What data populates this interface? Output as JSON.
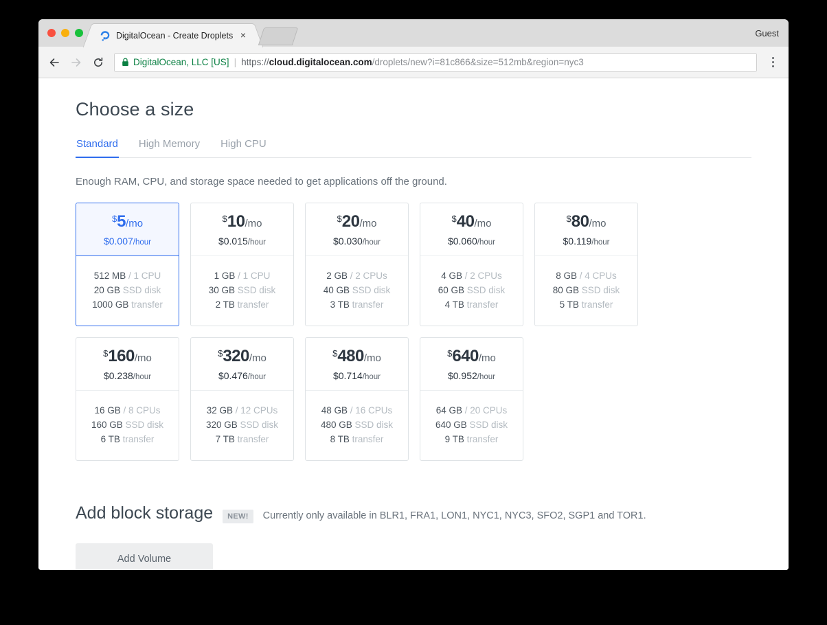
{
  "browser": {
    "tab": {
      "title": "DigitalOcean - Create Droplets",
      "favicon": "digitalocean-droplet-icon",
      "close": "×"
    },
    "profile_label": "Guest",
    "nav": {
      "back": "back-arrow-icon",
      "forward": "forward-arrow-icon",
      "reload": "reload-icon",
      "menu": "three-dot-menu-icon"
    },
    "omnibox": {
      "lock": "lock-icon",
      "security_name": "DigitalOcean, LLC [US]",
      "divider": "|",
      "url_scheme": "https://",
      "url_host": "cloud.digitalocean.com",
      "url_path": "/droplets/new?i=81c866&size=512mb&region=nyc3"
    }
  },
  "page": {
    "title": "Choose a size",
    "tabs": [
      {
        "label": "Standard",
        "active": true
      },
      {
        "label": "High Memory",
        "active": false
      },
      {
        "label": "High CPU",
        "active": false
      }
    ],
    "subtitle": "Enough RAM, CPU, and storage space needed to get applications off the ground.",
    "currency_symbol": "$",
    "per_month": "/mo",
    "per_hour": "/hour",
    "sizes": [
      {
        "price": "5",
        "hourly": "$0.007",
        "ram": "512 MB",
        "cpu": "1 CPU",
        "disk": "20 GB",
        "disk_label": "SSD disk",
        "transfer": "1000 GB",
        "transfer_label": "transfer",
        "selected": true
      },
      {
        "price": "10",
        "hourly": "$0.015",
        "ram": "1 GB",
        "cpu": "1 CPU",
        "disk": "30 GB",
        "disk_label": "SSD disk",
        "transfer": "2 TB",
        "transfer_label": "transfer",
        "selected": false
      },
      {
        "price": "20",
        "hourly": "$0.030",
        "ram": "2 GB",
        "cpu": "2 CPUs",
        "disk": "40 GB",
        "disk_label": "SSD disk",
        "transfer": "3 TB",
        "transfer_label": "transfer",
        "selected": false
      },
      {
        "price": "40",
        "hourly": "$0.060",
        "ram": "4 GB",
        "cpu": "2 CPUs",
        "disk": "60 GB",
        "disk_label": "SSD disk",
        "transfer": "4 TB",
        "transfer_label": "transfer",
        "selected": false
      },
      {
        "price": "80",
        "hourly": "$0.119",
        "ram": "8 GB",
        "cpu": "4 CPUs",
        "disk": "80 GB",
        "disk_label": "SSD disk",
        "transfer": "5 TB",
        "transfer_label": "transfer",
        "selected": false
      },
      {
        "price": "160",
        "hourly": "$0.238",
        "ram": "16 GB",
        "cpu": "8 CPUs",
        "disk": "160 GB",
        "disk_label": "SSD disk",
        "transfer": "6 TB",
        "transfer_label": "transfer",
        "selected": false
      },
      {
        "price": "320",
        "hourly": "$0.476",
        "ram": "32 GB",
        "cpu": "12 CPUs",
        "disk": "320 GB",
        "disk_label": "SSD disk",
        "transfer": "7 TB",
        "transfer_label": "transfer",
        "selected": false
      },
      {
        "price": "480",
        "hourly": "$0.714",
        "ram": "48 GB",
        "cpu": "16 CPUs",
        "disk": "480 GB",
        "disk_label": "SSD disk",
        "transfer": "8 TB",
        "transfer_label": "transfer",
        "selected": false
      },
      {
        "price": "640",
        "hourly": "$0.952",
        "ram": "64 GB",
        "cpu": "20 CPUs",
        "disk": "640 GB",
        "disk_label": "SSD disk",
        "transfer": "9 TB",
        "transfer_label": "transfer",
        "selected": false
      }
    ],
    "block_storage": {
      "title": "Add block storage",
      "badge": "NEW!",
      "note": "Currently only available in BLR1, FRA1, LON1, NYC1, NYC3, SFO2, SGP1 and TOR1.",
      "button_label": "Add Volume"
    }
  },
  "colors": {
    "accent": "#2f6ded",
    "selected_bg": "#f4f7ff",
    "secure_green": "#0b8043",
    "text_dark": "#2d3640",
    "text_muted": "#b4bbc1"
  }
}
